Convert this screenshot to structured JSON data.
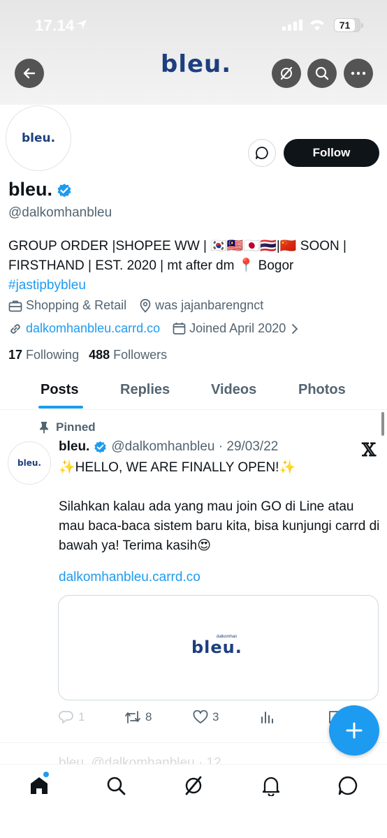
{
  "status_bar": {
    "time": "17.14",
    "battery": "71"
  },
  "header": {
    "banner_logo": "bleu.",
    "back_icon": "arrow-left-icon",
    "grok_icon": "grok-icon",
    "search_icon": "search-icon",
    "more_icon": "more-icon"
  },
  "profile": {
    "avatar_text": "bleu.",
    "display_name": "bleu.",
    "handle": "@dalkomhanbleu",
    "follow_label": "Follow",
    "bio_line1": "GROUP ORDER |SHOPEE WW | 🇰🇷🇲🇾🇯🇵🇹🇭|🇨🇳 SOON |",
    "bio_line2": "FIRSTHAND | EST. 2020 | mt after dm 📍 Bogor",
    "bio_hashtag": "#jastipbybleu",
    "category": "Shopping & Retail",
    "location": "was jajanbarengnct",
    "website": "dalkomhanbleu.carrd.co",
    "joined": "Joined April 2020",
    "following_count": "17",
    "following_label": "Following",
    "followers_count": "488",
    "followers_label": "Followers"
  },
  "tabs": [
    {
      "label": "Posts",
      "active": true
    },
    {
      "label": "Replies",
      "active": false
    },
    {
      "label": "Videos",
      "active": false
    },
    {
      "label": "Photos",
      "active": false
    }
  ],
  "pinned_post": {
    "pinned_label": "Pinned",
    "avatar_text": "bleu.",
    "name": "bleu.",
    "handle_date": "@dalkomhanbleu · 29/03/22",
    "line1": "✨HELLO, WE ARE FINALLY OPEN!✨",
    "para1": "Silahkan kalau ada yang mau join GO di Line atau mau baca-baca sistem baru kita, bisa kunjungi carrd di bawah ya! Terima kasih😍",
    "link": "dalkomhanbleu.carrd.co",
    "card_logo": "bleu.",
    "card_sub": "dalkomhan",
    "replies": "1",
    "reposts": "8",
    "likes": "3"
  },
  "next_post_preview": "bleu. @dalkomhanbleu · 12",
  "colors": {
    "accent": "#1d9bf0",
    "brand_navy": "#1d3f7f",
    "text": "#0f1419",
    "muted": "#536471"
  }
}
